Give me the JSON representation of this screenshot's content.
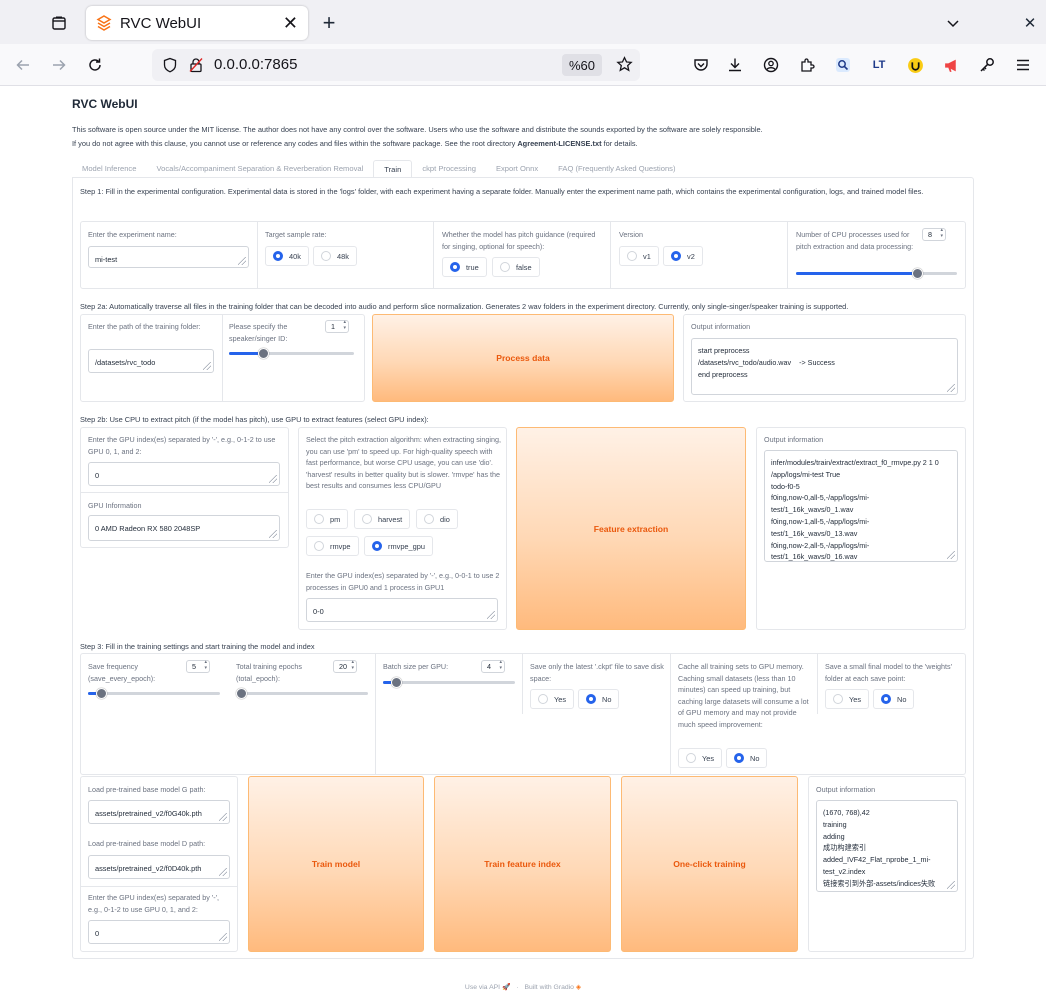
{
  "browser": {
    "tab_title": "RVC WebUI",
    "url": "0.0.0.0:7865",
    "zoom": "%60"
  },
  "app": {
    "title": "RVC WebUI",
    "notice_1": "This software is open source under the MIT license. The author does not have any control over the software. Users who use the software and distribute the sounds exported by the software are solely responsible.",
    "notice_2a": "If you do not agree with this clause, you cannot use or reference any codes and files within the software package. See the root directory ",
    "notice_2b": "Agreement-LICENSE.txt",
    "notice_2c": " for details."
  },
  "tabs": [
    "Model Inference",
    "Vocals/Accompaniment Separation & Reverberation Removal",
    "Train",
    "ckpt Processing",
    "Export Onnx",
    "FAQ (Frequently Asked Questions)"
  ],
  "step1": {
    "text": "Step 1: Fill in the experimental configuration. Experimental data is stored in the 'logs' folder, with each experiment having a separate folder. Manually enter the experiment name path, which contains the experimental configuration, logs, and trained model files.",
    "exp_label": "Enter the experiment name:",
    "exp_value": "mi-test",
    "sr_label": "Target sample rate:",
    "sr_options": [
      "40k",
      "48k"
    ],
    "pitch_label": "Whether the model has pitch guidance (required for singing, optional for speech):",
    "pitch_options": [
      "true",
      "false"
    ],
    "version_label": "Version",
    "version_options": [
      "v1",
      "v2"
    ],
    "cpu_label": "Number of CPU processes used for pitch extraction and data processing:",
    "cpu_value": "8",
    "cpu_level": 0.75
  },
  "step2a": {
    "text": "Step 2a: Automatically traverse all files in the training folder that can be decoded into audio and perform slice normalization. Generates 2 wav folders in the experiment directory. Currently, only single-singer/speaker training is supported.",
    "path_label": "Enter the path of the training folder:",
    "path_value": "/datasets/rvc_todo",
    "spk_label": "Please specify the speaker/singer ID:",
    "spk_value": "1",
    "spk_level": 0.27,
    "process_button": "Process data",
    "output_label": "Output information",
    "output_text": "start preprocess\n/datasets/rvc_todo/audio.wav    -> Success\nend preprocess"
  },
  "step2b": {
    "text": "Step 2b: Use CPU to extract pitch (if the model has pitch), use GPU to extract features (select GPU index):",
    "gpu_label": "Enter the GPU index(es) separated by '-', e.g., 0-1-2 to use GPU 0, 1, and 2:",
    "gpu_value": "0",
    "gpuinfo_label": "GPU Information",
    "gpuinfo_value": "0 AMD Radeon RX 580 2048SP",
    "algo_label": "Select the pitch extraction algorithm: when extracting singing, you can use 'pm' to speed up. For high-quality speech with fast performance, but worse CPU usage, you can use 'dio'. 'harvest' results in better quality but is slower. 'rmvpe' has the best results and consumes less CPU/GPU",
    "algo_options": [
      "pm",
      "harvest",
      "dio",
      "rmvpe",
      "rmvpe_gpu"
    ],
    "gpu2_label": "Enter the GPU index(es) separated by '-', e.g., 0-0-1 to use 2 processes in GPU0 and 1 process in GPU1",
    "gpu2_value": "0-0",
    "extract_button": "Feature extraction",
    "output_label": "Output information",
    "output_text": "infer/modules/train/extract/extract_f0_rmvpe.py 2 1 0 /app/logs/mi-test True\ntodo-f0-5\nf0ing,now-0,all-5,-/app/logs/mi-test/1_16k_wavs/0_1.wav\nf0ing,now-1,all-5,-/app/logs/mi-test/1_16k_wavs/0_13.wav\nf0ing,now-2,all-5,-/app/logs/mi-test/1_16k_wavs/0_16.wav"
  },
  "step3": {
    "text": "Step 3: Fill in the training settings and start training the model and index",
    "save_freq_label": "Save frequency (save_every_epoch):",
    "save_freq_value": "5",
    "save_freq_level": 0.1,
    "epochs_label": "Total training epochs (total_epoch):",
    "epochs_value": "20",
    "epochs_level": 0.04,
    "batch_label": "Batch size per GPU:",
    "batch_value": "4",
    "batch_level": 0.1,
    "latest_label": "Save only the latest '.ckpt' file to save disk space:",
    "cache_label": "Cache all training sets to GPU memory. Caching small datasets (less than 10 minutes) can speed up training, but caching large datasets will consume a lot of GPU memory and may not provide much speed improvement:",
    "small_label": "Save a small final model to the 'weights' folder at each save point:",
    "yes": "Yes",
    "no": "No",
    "g_label": "Load pre-trained base model G path:",
    "g_value": "assets/pretrained_v2/f0G40k.pth",
    "d_label": "Load pre-trained base model D path:",
    "d_value": "assets/pretrained_v2/f0D40k.pth",
    "gpu_label": "Enter the GPU index(es) separated by '-', e.g., 0-1-2 to use GPU 0, 1, and 2:",
    "gpu_value": "0",
    "train_button": "Train model",
    "index_button": "Train feature index",
    "oneclick_button": "One-click training",
    "output_label": "Output information",
    "output_text": "(1670, 768),42\ntraining\nadding\n成功构建索引\nadded_IVF42_Flat_nprobe_1_mi-test_v2.index\n链接索引到外部-assets/indices失败"
  },
  "footer": {
    "api": "Use via API",
    "sep": "·",
    "built": "Built with Gradio"
  }
}
